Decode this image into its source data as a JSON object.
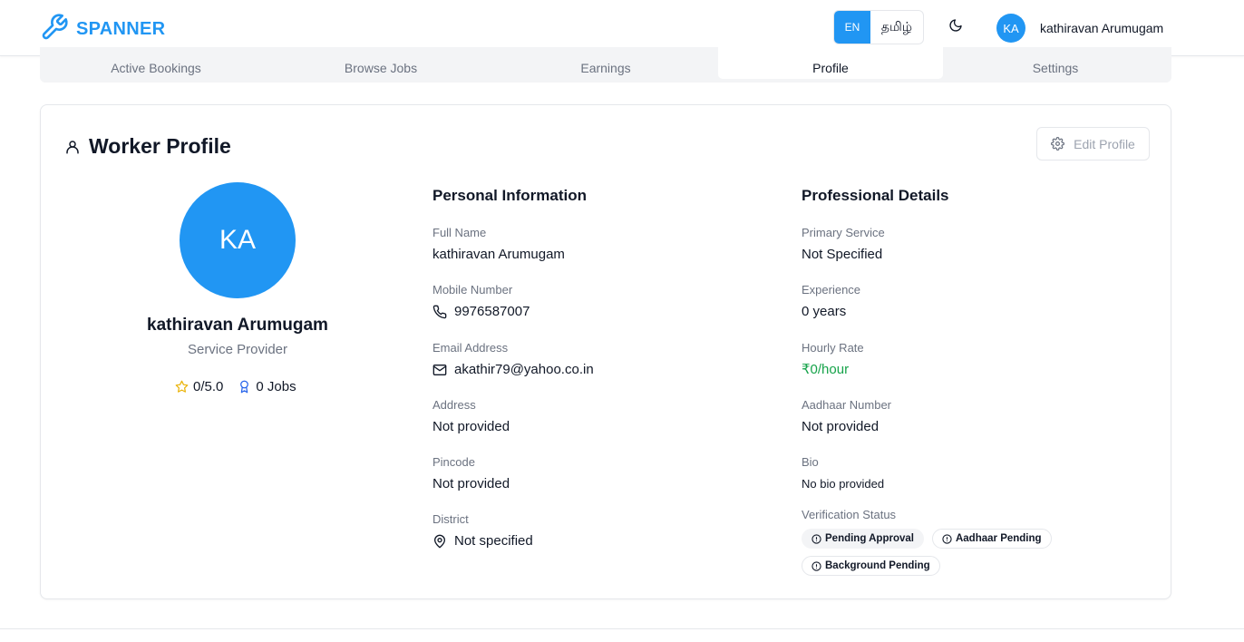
{
  "header": {
    "brand": "SPANNER",
    "lang_en": "EN",
    "lang_ta": "தமிழ்",
    "user_initials": "KA",
    "user_name": "kathiravan Arumugam"
  },
  "tabs": [
    "Active Bookings",
    "Browse Jobs",
    "Earnings",
    "Profile",
    "Settings"
  ],
  "active_tab": "Profile",
  "card": {
    "title": "Worker Profile",
    "edit_label": "Edit Profile"
  },
  "profile": {
    "initials": "KA",
    "name": "kathiravan Arumugam",
    "role": "Service Provider",
    "rating": "0/5.0",
    "jobs": "0 Jobs"
  },
  "personal": {
    "title": "Personal Information",
    "full_name_label": "Full Name",
    "full_name": "kathiravan Arumugam",
    "mobile_label": "Mobile Number",
    "mobile": "9976587007",
    "email_label": "Email Address",
    "email": "akathir79@yahoo.co.in",
    "address_label": "Address",
    "address": "Not provided",
    "pincode_label": "Pincode",
    "pincode": "Not provided",
    "district_label": "District",
    "district": "Not specified"
  },
  "professional": {
    "title": "Professional Details",
    "primary_service_label": "Primary Service",
    "primary_service": "Not Specified",
    "experience_label": "Experience",
    "experience": "0 years",
    "hourly_rate_label": "Hourly Rate",
    "hourly_rate": "₹0/hour",
    "aadhaar_label": "Aadhaar Number",
    "aadhaar": "Not provided",
    "bio_label": "Bio",
    "bio": "No bio provided",
    "verification_label": "Verification Status",
    "badges": [
      "Pending Approval",
      "Aadhaar Pending",
      "Background Pending"
    ]
  },
  "colors": {
    "accent": "#2196f3",
    "rate_green": "#16a34a",
    "star": "#eab308"
  }
}
